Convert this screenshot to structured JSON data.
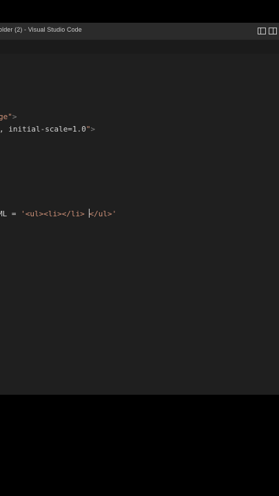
{
  "window": {
    "title": "older (2) - Visual Studio Code"
  },
  "title_bar_icons": [
    {
      "name": "toggle-primary-sidebar-icon"
    },
    {
      "name": "toggle-panel-icon"
    }
  ],
  "editor": {
    "lines": [
      {
        "text_a": "ge",
        "text_b": "\"",
        "text_c": ">"
      },
      {
        "text_a": ", initial-scale=1.0",
        "text_b": "\"",
        "text_c": ">"
      },
      {
        "text_a": "ML = ",
        "text_b": "'<ul><li></li> ",
        "text_c": "</ul>'"
      }
    ]
  },
  "colors": {
    "editor_background": "#1f1f1f",
    "title_bar_background": "#2b2b2b",
    "string_color": "#ce9178",
    "punctuation_color": "#808080",
    "plain_text_color": "#d4d4d4"
  }
}
